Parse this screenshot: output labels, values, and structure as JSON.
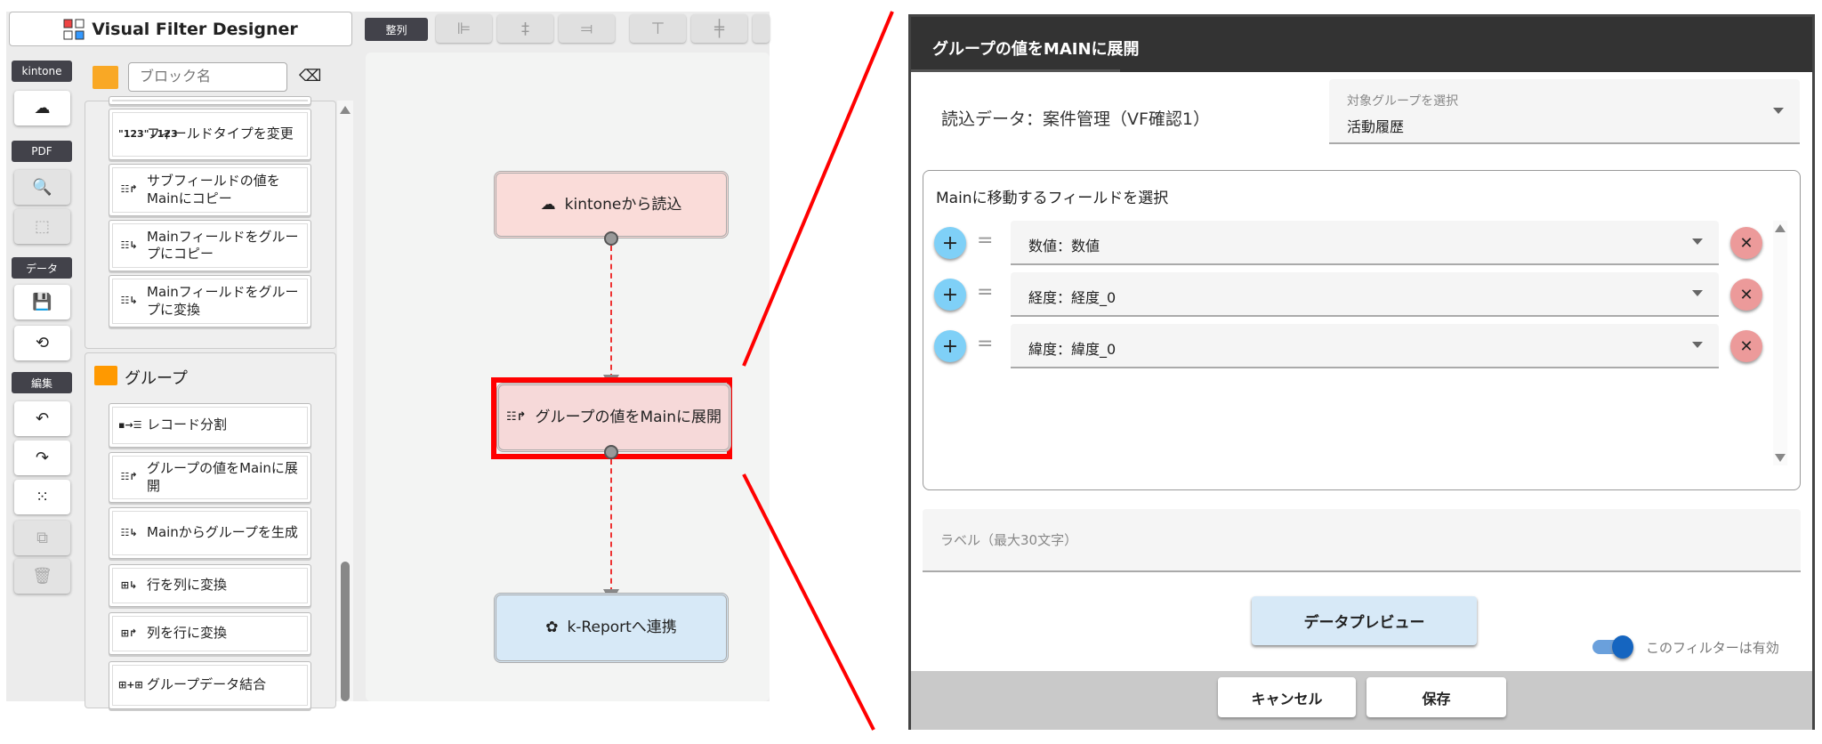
{
  "app": {
    "title": "Visual Filter Designer"
  },
  "toolbar": {
    "align_label": "整列",
    "align_icons": [
      "align-left-icon",
      "align-center-h-icon",
      "align-right-icon",
      "align-top-icon",
      "align-center-v-icon",
      "align-bottom-icon"
    ]
  },
  "sidebar": {
    "kintone": "kintone",
    "pdf": "PDF",
    "data": "データ",
    "edit": "編集"
  },
  "search": {
    "placeholder": "ブロック名"
  },
  "blocks": {
    "items1": [
      {
        "icon": "\"123\"↓123",
        "label": "フィールドタイプを変更"
      },
      {
        "icon": "☷↱",
        "label": "サブフィールドの値をMainにコピー"
      },
      {
        "icon": "☷↳",
        "label": "Mainフィールドをグループにコピー"
      },
      {
        "icon": "☷↳",
        "label": "Mainフィールドをグループに変換"
      }
    ],
    "group_title": "グループ",
    "items2": [
      {
        "icon": "▪→☰",
        "label": "レコード分割"
      },
      {
        "icon": "☷↱",
        "label": "グループの値をMainに展開"
      },
      {
        "icon": "☷↳",
        "label": "Mainからグループを生成"
      },
      {
        "icon": "⊞↳",
        "label": "行を列に変換"
      },
      {
        "icon": "⊞↱",
        "label": "列を行に変換"
      },
      {
        "icon": "⊞+⊞",
        "label": "グループデータ結合"
      }
    ]
  },
  "canvas": {
    "node1": "kintoneから読込",
    "node2": "グループの値をMainに展開",
    "node3": "k-Reportへ連携"
  },
  "dialog": {
    "title": "グループの値をMAINに展開",
    "source": "読込データ：案件管理（VF確認1）",
    "group_select": {
      "label": "対象グループを選択",
      "value": "活動履歴"
    },
    "fields_title": "Mainに移動するフィールドを選択",
    "fields": [
      "数値：数値",
      "経度：経度_0",
      "緯度：緯度_0"
    ],
    "label_placeholder": "ラベル（最大30文字）",
    "preview": "データプレビュー",
    "toggle_label": "このフィルターは有効",
    "toggle_on": true,
    "cancel": "キャンセル",
    "save": "保存"
  },
  "colors": {
    "highlight": "#ff0000",
    "toggle": "#1565c0",
    "plus": "#7fd0f7",
    "remove": "#ec9a9a"
  }
}
